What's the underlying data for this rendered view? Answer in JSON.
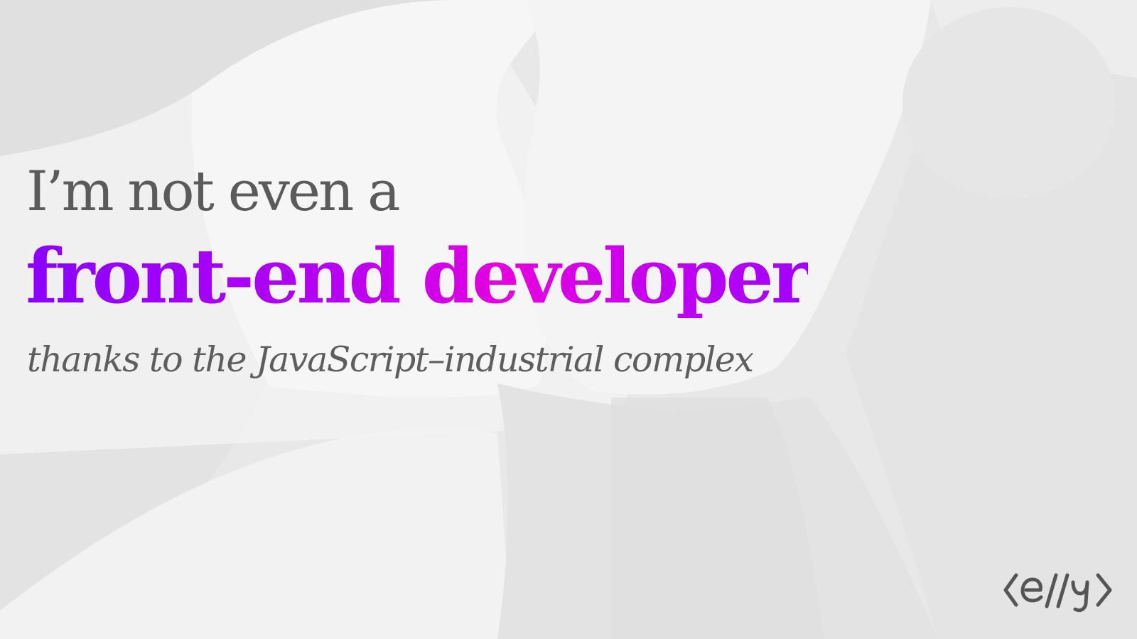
{
  "slide": {
    "intro": "I’m not even a",
    "headline": "front-end developer",
    "tagline": "thanks to the JavaScript–industrial complex"
  },
  "logo": {
    "icon": "code-brackets-logo-icon",
    "text": "<e//y>"
  },
  "colors": {
    "background": "#ececec",
    "text_gray": "#5b5b5b",
    "gradient_start": "#8a00ff",
    "gradient_mid": "#e600e0",
    "gradient_end": "#a000ff"
  }
}
